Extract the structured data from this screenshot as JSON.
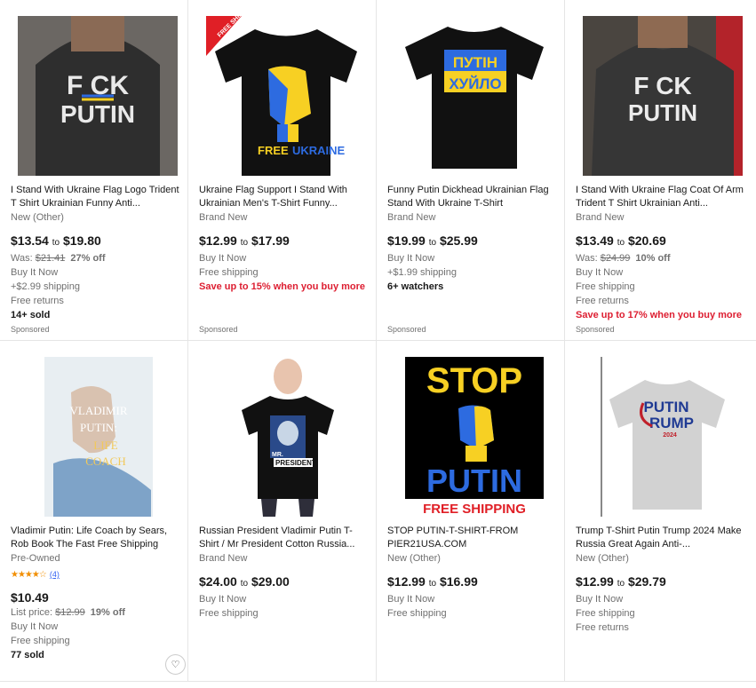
{
  "items": [
    {
      "title": "I Stand With Ukraine Flag Logo Trident T Shirt Ukrainian Funny Anti...",
      "condition": "New (Other)",
      "price_from": "$13.54",
      "price_to": "$19.80",
      "to": "to",
      "was_label": "Was:",
      "was_price": "$21.41",
      "discount": "27% off",
      "buy": "Buy It Now",
      "shipping": "+$2.99 shipping",
      "returns": "Free returns",
      "sold": "14+ sold",
      "sponsored": "Sponsored",
      "image_text": {
        "l1": "F CK",
        "l2": "PUTIN"
      }
    },
    {
      "title": "Ukraine Flag Support I Stand With Ukrainian Men's T-Shirt Funny...",
      "condition": "Brand New",
      "price_from": "$12.99",
      "price_to": "$17.99",
      "to": "to",
      "buy": "Buy It Now",
      "shipping": "Free shipping",
      "promo": "Save up to 15% when you buy more",
      "sponsored": "Sponsored",
      "image_text": {
        "ribbon": "FREE SHIPPING",
        "l1": "FREE",
        "l2": "UKRAINE"
      }
    },
    {
      "title": "Funny Putin Dickhead Ukrainian Flag Stand With Ukraine T-Shirt",
      "condition": "Brand New",
      "price_from": "$19.99",
      "price_to": "$25.99",
      "to": "to",
      "buy": "Buy It Now",
      "shipping": "+$1.99 shipping",
      "watchers": "6+ watchers",
      "sponsored": "Sponsored",
      "image_text": {
        "l1": "ПУТІН",
        "l2": "ХУЙЛО"
      }
    },
    {
      "title": "I Stand With Ukraine Flag Coat Of Arm Trident T Shirt Ukrainian Anti...",
      "condition": "Brand New",
      "price_from": "$13.49",
      "price_to": "$20.69",
      "to": "to",
      "was_label": "Was:",
      "was_price": "$24.99",
      "discount": "10% off",
      "buy": "Buy It Now",
      "shipping": "Free shipping",
      "returns": "Free returns",
      "promo": "Save up to 17% when you buy more",
      "sponsored": "Sponsored",
      "image_text": {
        "l1": "F CK",
        "l2": "PUTIN"
      }
    },
    {
      "title": "Vladimir Putin: Life Coach by Sears, Rob Book The Fast Free Shipping",
      "condition": "Pre-Owned",
      "rating_stars": "★★★★☆",
      "rating_count": "(4)",
      "price": "$10.49",
      "list_label": "List price:",
      "list_price": "$12.99",
      "discount": "19% off",
      "buy": "Buy It Now",
      "shipping": "Free shipping",
      "sold": "77 sold",
      "image_text": {
        "l1": "VLADIMIR",
        "l2": "PUTIN:",
        "l3": "LIFE",
        "l4": "COACH"
      }
    },
    {
      "title": "Russian President Vladimir Putin T-Shirt / Mr President Cotton Russia...",
      "condition": "Brand New",
      "price_from": "$24.00",
      "price_to": "$29.00",
      "to": "to",
      "buy": "Buy It Now",
      "shipping": "Free shipping",
      "image_text": {
        "l1": "MR.",
        "l2": "PRESIDENT"
      }
    },
    {
      "title": "STOP PUTIN-T-SHIRT-FROM PIER21USA.COM",
      "condition": "New (Other)",
      "price_from": "$12.99",
      "price_to": "$16.99",
      "to": "to",
      "buy": "Buy It Now",
      "shipping": "Free shipping",
      "image_text": {
        "l1": "STOP",
        "l2": "PUTIN",
        "l3": "FREE SHIPPING"
      }
    },
    {
      "title": "Trump T-Shirt Putin Trump 2024 Make Russia Great Again Anti-...",
      "condition": "New (Other)",
      "price_from": "$12.99",
      "price_to": "$29.79",
      "to": "to",
      "buy": "Buy It Now",
      "shipping": "Free shipping",
      "returns": "Free returns",
      "image_text": {
        "l1": "PUTIN",
        "l2": "RUMP",
        "l3": "2024"
      }
    }
  ],
  "colors": {
    "promo_red": "#dd1e31",
    "link_blue": "#3665f3",
    "star_orange": "#f18e00"
  }
}
